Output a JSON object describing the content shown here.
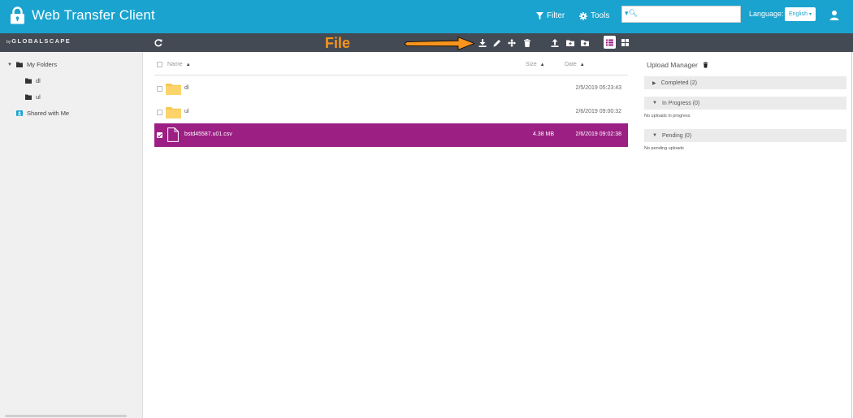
{
  "header": {
    "title": "Web Transfer Client",
    "filter_label": "Filter",
    "tools_label": "Tools",
    "search": {
      "value": "",
      "placeholder": ""
    },
    "language_label": "Language:",
    "language_value": "English",
    "colors": {
      "header_bg": "#1aa3cf",
      "toolbar_bg": "#434a54",
      "selected_row": "#9c1f84",
      "annotation": "#f7941d"
    }
  },
  "toolbar": {
    "logo_prefix": "by",
    "logo_text": "GLOBALSCAPE",
    "icons": [
      "refresh-icon",
      "download-icon",
      "rename-icon",
      "move-icon",
      "delete-icon",
      "upload-icon",
      "new-folder-icon",
      "folder-upload-icon",
      "list-view-icon",
      "grid-view-icon"
    ]
  },
  "annotation": {
    "label": "File"
  },
  "sidebar": {
    "items": [
      {
        "label": "My Folders",
        "icon": "folder-icon",
        "expanded": true
      },
      {
        "label": "dl",
        "icon": "folder-icon"
      },
      {
        "label": "ul",
        "icon": "folder-icon"
      },
      {
        "label": "Shared with Me",
        "icon": "shared-icon"
      }
    ]
  },
  "filelist": {
    "columns": {
      "name": "Name",
      "size": "Size",
      "date": "Date"
    },
    "rows": [
      {
        "type": "folder",
        "name": "dl",
        "size": "",
        "date": "2/5/2019 05:23:43",
        "selected": false
      },
      {
        "type": "folder",
        "name": "ul",
        "size": "",
        "date": "2/6/2019 09:00:32",
        "selected": false
      },
      {
        "type": "file",
        "name": "bstd45587.u01.csv",
        "size": "4.38 MB",
        "date": "2/6/2019 09:02:38",
        "selected": true
      }
    ]
  },
  "upload_manager": {
    "title": "Upload Manager",
    "sections": [
      {
        "label": "Completed (2)",
        "expanded": false,
        "note": ""
      },
      {
        "label": "In Progress (0)",
        "expanded": true,
        "note": "No uploads in progress"
      },
      {
        "label": "Pending (0)",
        "expanded": true,
        "note": "No pending uploads"
      }
    ]
  }
}
